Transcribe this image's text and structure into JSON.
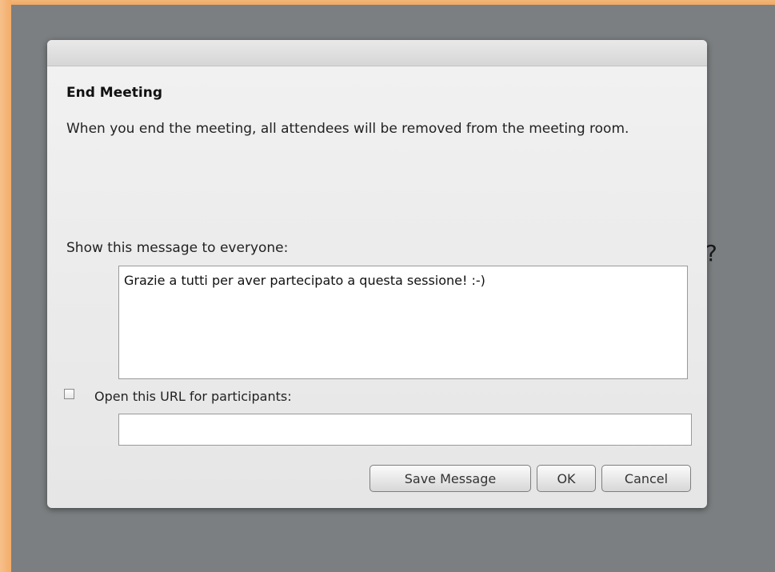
{
  "background": {
    "partial_text": "?"
  },
  "dialog": {
    "title": "End Meeting",
    "description": "When you end the meeting, all attendees will be removed from the meeting room.",
    "message_label": "Show this message to everyone:",
    "message_value": "Grazie a tutti per aver partecipato a questa sessione! :-)",
    "url_checkbox_checked": false,
    "url_label": "Open this URL for participants:",
    "url_value": "",
    "buttons": {
      "save": "Save Message",
      "ok": "OK",
      "cancel": "Cancel"
    }
  },
  "colors": {
    "backdrop": "#7b7f81",
    "frame_accent": "#f3ad6a",
    "dialog_bg": "#ededed"
  }
}
